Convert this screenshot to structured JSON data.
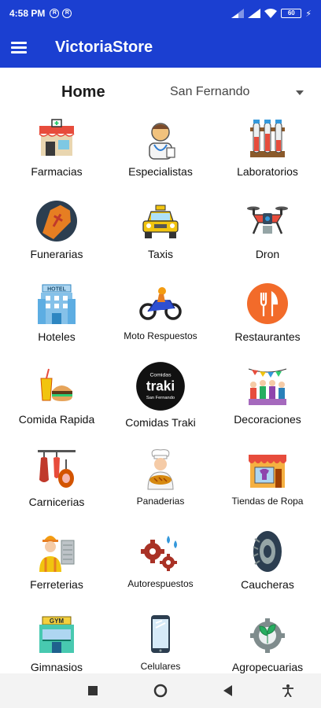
{
  "status_bar": {
    "time": "4:58 PM",
    "battery": "60"
  },
  "app": {
    "title": "VictoriaStore"
  },
  "header": {
    "title": "Home",
    "city": "San Fernando"
  },
  "categories": [
    {
      "label": "Farmacias",
      "icon": "pharmacy-icon"
    },
    {
      "label": "Especialistas",
      "icon": "doctor-icon"
    },
    {
      "label": "Laboratorios",
      "icon": "test-tubes-icon"
    },
    {
      "label": "Funerarias",
      "icon": "coffin-icon"
    },
    {
      "label": "Taxis",
      "icon": "taxi-icon"
    },
    {
      "label": "Dron",
      "icon": "drone-icon"
    },
    {
      "label": "Hoteles",
      "icon": "hotel-icon"
    },
    {
      "label": "Moto Respuestos",
      "icon": "motorcycle-icon"
    },
    {
      "label": "Restaurantes",
      "icon": "restaurant-icon"
    },
    {
      "label": "Comida Rapida",
      "icon": "fast-food-icon"
    },
    {
      "label": "Comidas Traki",
      "icon": "traki-logo-icon",
      "logo_text": "traki",
      "logo_top": "Comidas",
      "logo_bottom": "San Fernando"
    },
    {
      "label": "Decoraciones",
      "icon": "party-flags-icon"
    },
    {
      "label": "Carnicerias",
      "icon": "meat-icon"
    },
    {
      "label": "Panaderias",
      "icon": "baker-icon"
    },
    {
      "label": "Tiendas de Ropa",
      "icon": "clothing-store-icon"
    },
    {
      "label": "Ferreterias",
      "icon": "construction-worker-icon"
    },
    {
      "label": "Autorespuestos",
      "icon": "gears-icon"
    },
    {
      "label": "Caucheras",
      "icon": "tire-icon"
    },
    {
      "label": "Gimnasios",
      "icon": "gym-icon",
      "sign": "GYM"
    },
    {
      "label": "Celulares",
      "icon": "smartphone-icon"
    },
    {
      "label": "Agropecuarias",
      "icon": "agro-gear-icon"
    }
  ],
  "hotel_sign": "HOTEL",
  "colors": {
    "appbar": "#1b3fd1",
    "restaurant": "#f26b2a"
  }
}
